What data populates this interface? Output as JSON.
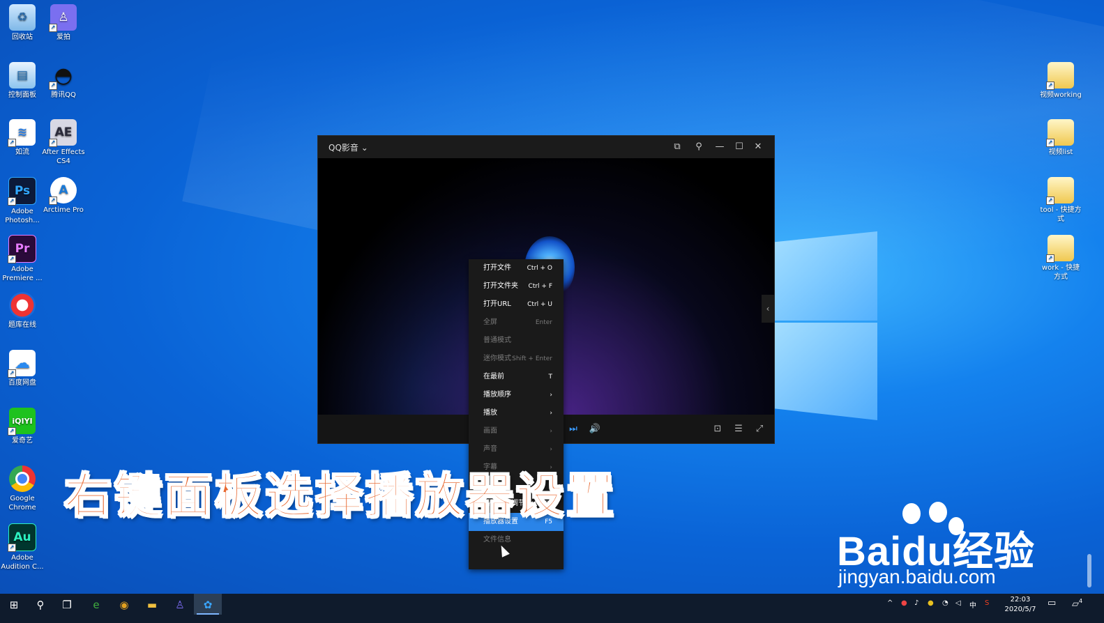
{
  "desktop": {
    "left_icons": [
      {
        "label": "回收站",
        "icon": "recycle-bin-icon"
      },
      {
        "label": "爱拍",
        "icon": "aipai-icon"
      },
      {
        "label": "控制面板",
        "icon": "control-panel-icon"
      },
      {
        "label": "腾讯QQ",
        "icon": "qq-penguin-icon"
      },
      {
        "label": "如流",
        "icon": "ruliu-icon"
      },
      {
        "label": "After Effects CS4",
        "icon": "after-effects-icon",
        "glyph": "AE"
      },
      {
        "label": "Adobe Photosh...",
        "icon": "photoshop-icon",
        "glyph": "Ps"
      },
      {
        "label": "Arctime Pro",
        "icon": "arctime-icon",
        "glyph": "A"
      },
      {
        "label": "Adobe Premiere ...",
        "icon": "premiere-icon",
        "glyph": "Pr"
      },
      {
        "label": "题库在线",
        "icon": "tiku-icon"
      },
      {
        "label": "百度网盘",
        "icon": "baidu-netdisk-icon"
      },
      {
        "label": "爱奇艺",
        "icon": "iqiyi-icon",
        "glyph": "iQIYI"
      },
      {
        "label": "Google Chrome",
        "icon": "chrome-icon"
      },
      {
        "label": "Adobe Audition C...",
        "icon": "audition-icon",
        "glyph": "Au"
      }
    ],
    "right_icons": [
      {
        "label": "视频working",
        "icon": "folder-shortcut-icon"
      },
      {
        "label": "视频list",
        "icon": "folder-shortcut-icon"
      },
      {
        "label": "tool - 快捷方式",
        "icon": "folder-shortcut-icon"
      },
      {
        "label": "work - 快捷方式",
        "icon": "folder-shortcut-icon"
      }
    ]
  },
  "player": {
    "title": "QQ影音",
    "title_arrow": "⌄",
    "buttons": {
      "pip": "⧉",
      "pin": "⚲",
      "minimize": "—",
      "maximize": "☐",
      "close": "✕"
    },
    "side_arrow": "‹",
    "controls": {
      "next": "⏭",
      "volume": "🔊",
      "screenshot": "⊡",
      "settings": "☰",
      "fullscreen": "⤢"
    }
  },
  "context_menu": {
    "items": [
      {
        "label": "打开文件",
        "shortcut": "Ctrl + O",
        "state": "on"
      },
      {
        "label": "打开文件夹",
        "shortcut": "Ctrl + F",
        "state": "on"
      },
      {
        "label": "打开URL",
        "shortcut": "Ctrl + U",
        "state": "on"
      },
      {
        "label": "全屏",
        "shortcut": "Enter",
        "state": "dis"
      },
      {
        "label": "普通模式",
        "shortcut": "",
        "state": "dis"
      },
      {
        "label": "迷你模式",
        "shortcut": "Shift + Enter",
        "state": "dis"
      },
      {
        "label": "在最前",
        "shortcut": "T",
        "state": "on"
      },
      {
        "label": "播放顺序",
        "shortcut": "›",
        "state": "on"
      },
      {
        "label": "播放",
        "shortcut": "›",
        "state": "on"
      },
      {
        "label": "画面",
        "shortcut": "›",
        "state": "dis"
      },
      {
        "label": "声音",
        "shortcut": "›",
        "state": "dis"
      },
      {
        "label": "字幕",
        "shortcut": "›",
        "state": "dis"
      },
      {
        "label": "",
        "shortcut": "",
        "state": "dis"
      },
      {
        "label": "播放效果调节",
        "shortcut": "F4",
        "state": "on"
      },
      {
        "label": "播放器设置",
        "shortcut": "F5",
        "state": "hl"
      },
      {
        "label": "文件信息",
        "shortcut": "",
        "state": "dis"
      }
    ]
  },
  "caption": "右键面板选择播放器设置",
  "watermark": {
    "brand": "Baidu经验",
    "url": "jingyan.baidu.com"
  },
  "taskbar": {
    "start": "⊞",
    "search": "⚲",
    "taskview": "❐",
    "apps": [
      {
        "name": "360-browser-icon",
        "glyph": "e",
        "color": "#3fae3f"
      },
      {
        "name": "chrome-icon",
        "glyph": "◉",
        "color": "#e0a020"
      },
      {
        "name": "file-explorer-icon",
        "glyph": "▬",
        "color": "#f0c040"
      },
      {
        "name": "aipai-icon",
        "glyph": "♙",
        "color": "#7d6cf5"
      },
      {
        "name": "qq-player-icon",
        "glyph": "✿",
        "color": "#3aa6ff"
      }
    ],
    "tray": {
      "ime": "中",
      "up": "^"
    },
    "time": "22:03",
    "date": "2020/5/7",
    "notify_count": "4"
  }
}
